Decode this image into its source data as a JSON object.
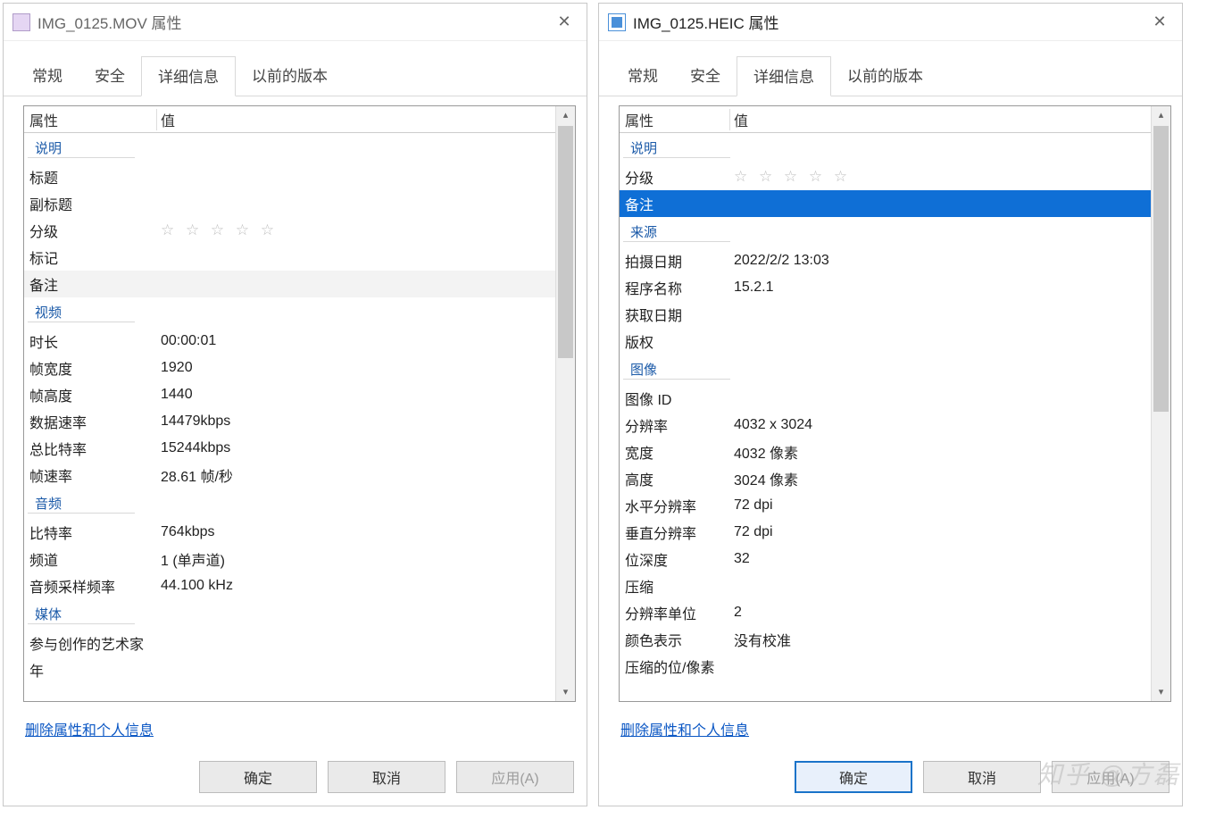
{
  "watermark": "知乎 @方磊",
  "headers": {
    "property": "属性",
    "value": "值"
  },
  "tabs": [
    "常规",
    "安全",
    "详细信息",
    "以前的版本"
  ],
  "stars": "☆ ☆ ☆ ☆ ☆",
  "link_text": "删除属性和个人信息",
  "buttons": {
    "ok": "确定",
    "cancel": "取消",
    "apply": "应用(A)"
  },
  "left": {
    "title": "IMG_0125.MOV 属性",
    "sections": {
      "desc": "说明",
      "video": "视频",
      "audio": "音频",
      "media": "媒体"
    },
    "rows": {
      "title_label": "标题",
      "subtitle_label": "副标题",
      "rating_label": "分级",
      "tag_label": "标记",
      "remark_label": "备注",
      "duration_label": "时长",
      "duration_value": "00:00:01",
      "fwidth_label": "帧宽度",
      "fwidth_value": "1920",
      "fheight_label": "帧高度",
      "fheight_value": "1440",
      "datarate_label": "数据速率",
      "datarate_value": "14479kbps",
      "totalbr_label": "总比特率",
      "totalbr_value": "15244kbps",
      "framerate_label": "帧速率",
      "framerate_value": "28.61 帧/秒",
      "abitrate_label": "比特率",
      "abitrate_value": "764kbps",
      "channels_label": "频道",
      "channels_value": "1 (单声道)",
      "asample_label": "音频采样频率",
      "asample_value": "44.100 kHz",
      "artist_label": "参与创作的艺术家",
      "year_label": "年"
    }
  },
  "right": {
    "title": "IMG_0125.HEIC 属性",
    "sections": {
      "desc": "说明",
      "source": "来源",
      "image": "图像"
    },
    "rows": {
      "rating_label": "分级",
      "remark_label": "备注",
      "shotdate_label": "拍摄日期",
      "shotdate_value": "2022/2/2 13:03",
      "program_label": "程序名称",
      "program_value": "15.2.1",
      "acqdate_label": "获取日期",
      "copyright_label": "版权",
      "imgid_label": "图像 ID",
      "res_label": "分辨率",
      "res_value": "4032 x 3024",
      "width_label": "宽度",
      "width_value": "4032 像素",
      "height_label": "高度",
      "height_value": "3024 像素",
      "hres_label": "水平分辨率",
      "hres_value": "72 dpi",
      "vres_label": "垂直分辨率",
      "vres_value": "72 dpi",
      "bitdepth_label": "位深度",
      "bitdepth_value": "32",
      "compress_label": "压缩",
      "resunit_label": "分辨率单位",
      "resunit_value": "2",
      "colorrep_label": "颜色表示",
      "colorrep_value": "没有校准",
      "cbpp_label": "压缩的位/像素"
    }
  }
}
